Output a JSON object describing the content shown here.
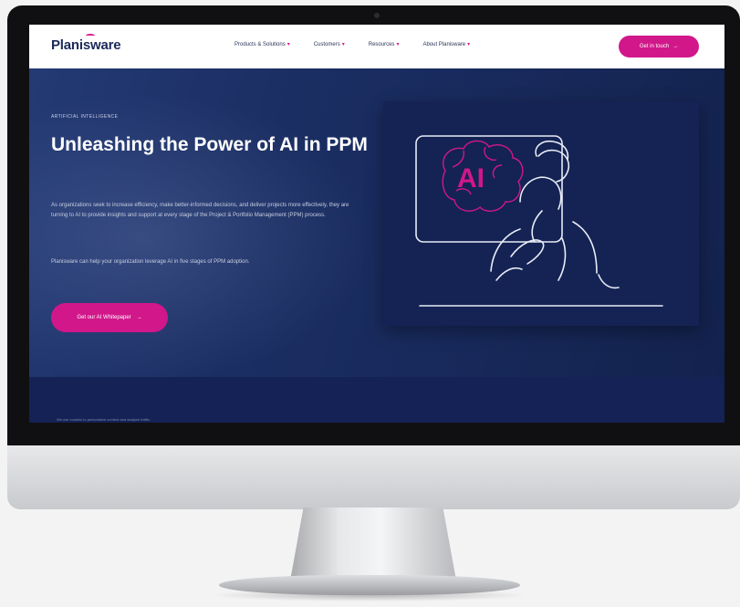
{
  "site": {
    "logo": "Planisware",
    "nav": [
      {
        "label": "Products & Solutions"
      },
      {
        "label": "Customers"
      },
      {
        "label": "Resources"
      },
      {
        "label": "About Planisware"
      }
    ],
    "cta": "Get in touch",
    "caret_icon": "chevron-down-icon"
  },
  "hero": {
    "eyebrow": "ARTIFICIAL INTELLIGENCE",
    "title": "Unleashing the Power of AI in PPM",
    "paragraph1": "As organizations seek to increase efficiency, make better-informed decisions, and deliver projects more effectively, they are turning to AI to provide insights and support at every stage of the Project & Portfolio Management (PPM) process.",
    "paragraph2": "Planisware can help your organization leverage AI in five stages of PPM adoption.",
    "cta": "Get our AI Whitepaper",
    "art_label": "AI"
  },
  "footer_band": {
    "text": "We use cookies to personalize content and analyze traffic."
  },
  "colors": {
    "accent": "#d1178a",
    "navy": "#1b2e63",
    "dark": "#142353"
  }
}
